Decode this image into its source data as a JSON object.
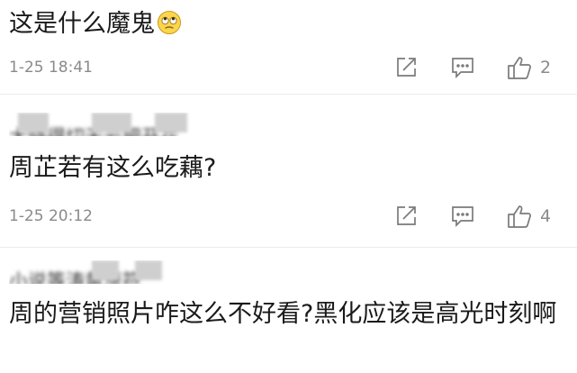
{
  "comments": [
    {
      "username_obscured": "",
      "text": "这是什么魔鬼",
      "emoji": "eye-roll-emoji",
      "time": "1-25 18:41",
      "likes": "2"
    },
    {
      "username_obscured": "大晓得切天云把开花",
      "text": "周芷若有这么吃藕?",
      "time": "1-25 20:12",
      "likes": "4"
    },
    {
      "username_obscured": "小说等涛黄涨符",
      "text": "周的营销照片咋这么不好看?黑化应该是高光时刻啊"
    }
  ],
  "icons": {
    "share": "share-icon",
    "comment": "comment-icon",
    "like": "thumbs-up-icon"
  },
  "colors": {
    "text": "#1a1a1a",
    "meta": "#8a8a8a",
    "divider": "#ececec",
    "icon": "#7a7a7a"
  }
}
